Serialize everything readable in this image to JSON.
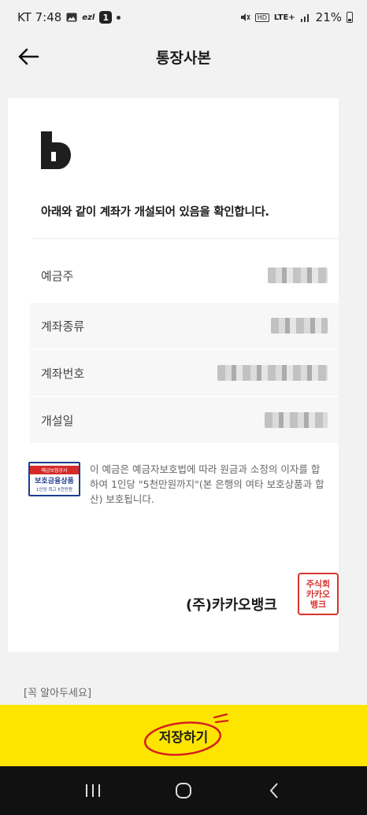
{
  "status_bar": {
    "left_text": "KT 7:48",
    "ezl_label": "ezl",
    "badge": "1",
    "network": "LTE+",
    "battery": "21%"
  },
  "header": {
    "title": "통장사본"
  },
  "card": {
    "logo_letter": "B",
    "headline": "아래와 같이 계좌가 개설되어 있음을 확인합니다.",
    "rows": [
      {
        "label": "예금주"
      },
      {
        "label": "계좌종류"
      },
      {
        "label": "계좌번호"
      },
      {
        "label": "개설일"
      }
    ],
    "badge": {
      "top": "예금보험공사",
      "middle": "보호금융상품",
      "bottom": "1인당 최고 5천만원"
    },
    "notice": "이 예금은 예금자보호법에 따라 원금과 소정의 이자를 합하여 1인당 \"5천만원까지\"(본 은행의 여타 보호상품과 합산) 보호됩니다.",
    "company": "(주)카카오뱅크",
    "seal_text": "주식회사카카오뱅크"
  },
  "footer": {
    "link": "[꼭 알아두세요]"
  },
  "save_button": {
    "label": "저장하기"
  },
  "colors": {
    "accent_yellow": "#fee500",
    "seal_red": "#d8332e",
    "badge_blue": "#1e3c8c"
  }
}
